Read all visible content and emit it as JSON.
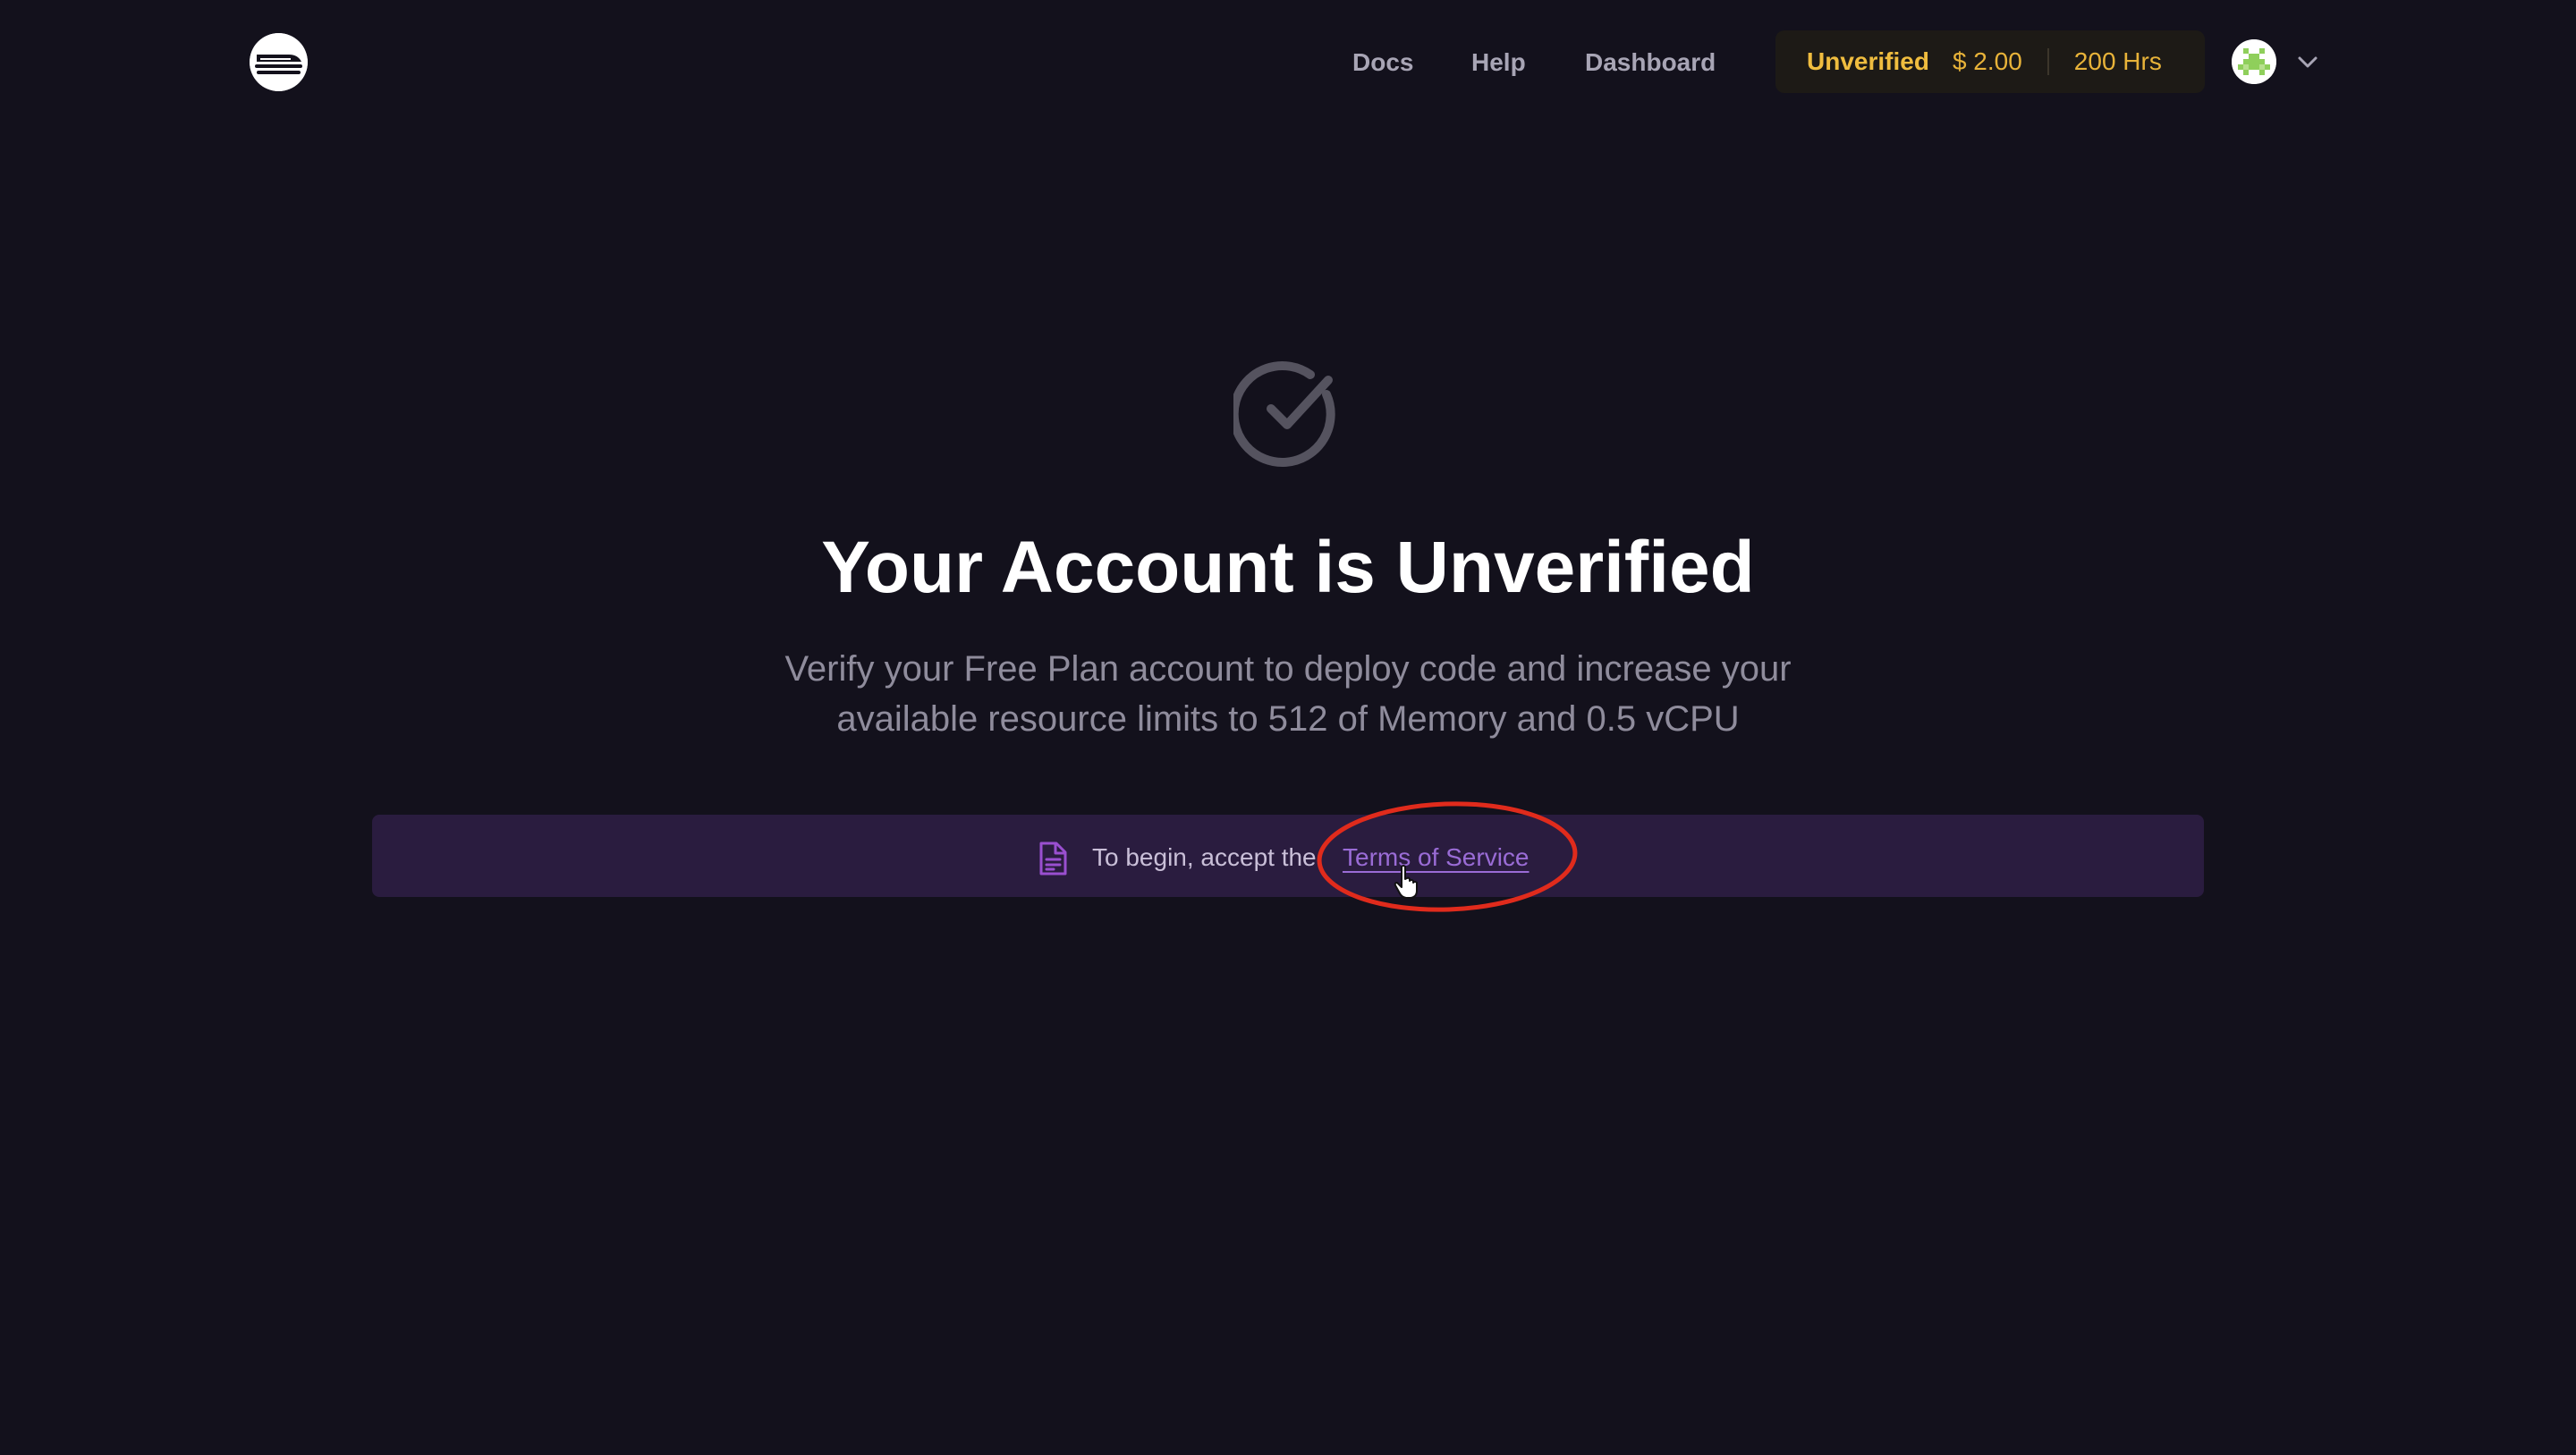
{
  "header": {
    "logo_icon": "railway-logo-icon",
    "nav": {
      "docs": "Docs",
      "help": "Help",
      "dashboard": "Dashboard"
    },
    "usage": {
      "status": "Unverified",
      "credit": "$ 2.00",
      "hours": "200 Hrs"
    },
    "avatar_icon": "pixel-avatar-icon",
    "menu_icon": "chevron-down-icon"
  },
  "main": {
    "status_icon": "check-circle-icon",
    "title": "Your Account is Unverified",
    "subtitle_line1": "Verify your Free Plan account to deploy code and increase your",
    "subtitle_line2": "available resource limits to 512 of Memory and 0.5 vCPU",
    "notice": {
      "icon": "document-icon",
      "text": "To begin, accept the",
      "link": "Terms of Service"
    }
  },
  "overlay": {
    "annotation": "red-ellipse-highlight",
    "cursor": "hand-pointer-icon"
  },
  "colors": {
    "background": "#13111c",
    "accent_purple": "#9a6cd6",
    "warning_yellow": "#f0bd3f",
    "annotation_red": "#e02b1c"
  }
}
